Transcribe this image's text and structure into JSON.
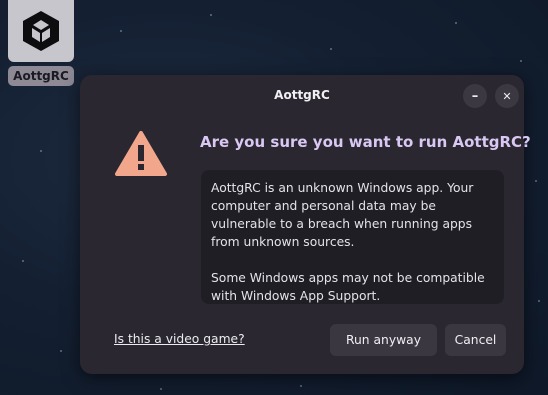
{
  "desktop": {
    "icon_label": "AottgRC",
    "icon": "unity-logo-icon"
  },
  "dialog": {
    "title": "AottgRC",
    "minimize_icon": "minimize-icon",
    "minimize_glyph": "–",
    "close_icon": "close-icon",
    "close_glyph": "✕",
    "warning_icon": "warning-triangle-icon",
    "heading": "Are you sure you want to run AottgRC?",
    "message_p1": "AottgRC is an unknown Windows app. Your computer and personal data may be vulnerable to a breach when running apps from unknown sources.",
    "message_p2": "Some Windows apps may not be compatible with Windows App Support.",
    "video_game_link": "Is this a video game?",
    "run_button": "Run anyway",
    "cancel_button": "Cancel"
  },
  "colors": {
    "dialog_bg": "#2a2730",
    "heading": "#d9c8f3",
    "warning": "#f2a78c",
    "button_bg": "#3a3741"
  }
}
